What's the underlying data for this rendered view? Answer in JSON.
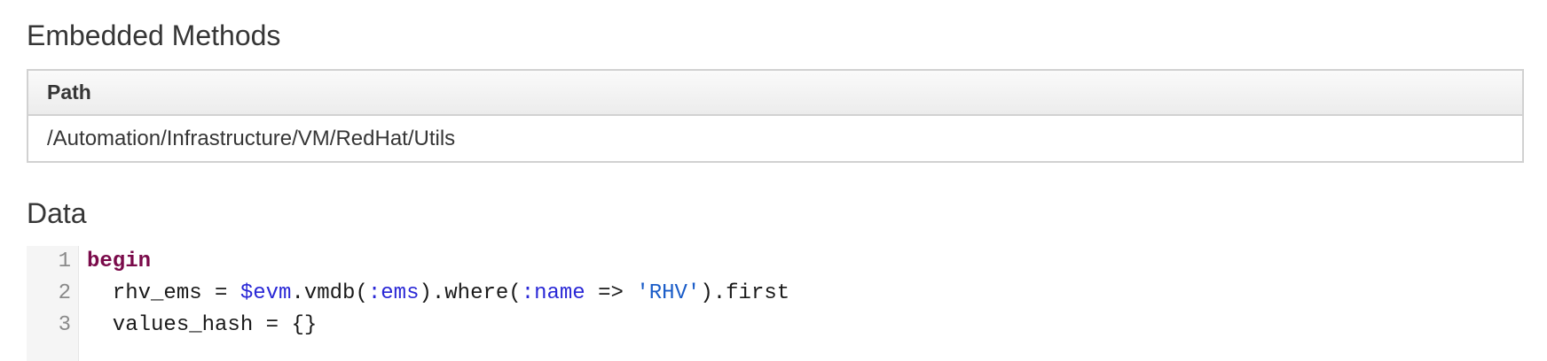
{
  "embedded_methods": {
    "heading": "Embedded Methods",
    "table": {
      "columns": [
        "Path"
      ],
      "rows": [
        [
          "/Automation/Infrastructure/VM/RedHat/Utils"
        ]
      ]
    }
  },
  "data_section": {
    "heading": "Data",
    "code_lines": [
      {
        "number": "1",
        "tokens": [
          {
            "text": "begin",
            "kind": "keyword"
          }
        ]
      },
      {
        "number": "2",
        "tokens": [
          {
            "text": "  rhv_ems = ",
            "kind": "plain"
          },
          {
            "text": "$evm",
            "kind": "global-variable"
          },
          {
            "text": ".vmdb(",
            "kind": "plain"
          },
          {
            "text": ":ems",
            "kind": "symbol"
          },
          {
            "text": ").where(",
            "kind": "plain"
          },
          {
            "text": ":name",
            "kind": "symbol"
          },
          {
            "text": " => ",
            "kind": "plain"
          },
          {
            "text": "'RHV'",
            "kind": "string"
          },
          {
            "text": ").first",
            "kind": "plain"
          }
        ]
      },
      {
        "number": "3",
        "tokens": [
          {
            "text": "  values_hash = {}",
            "kind": "plain"
          }
        ]
      }
    ]
  },
  "colors": {
    "keyword": "#7a0a4a",
    "global_variable": "#2a28d6",
    "symbol": "#2a28d6",
    "string": "#1a5cc8",
    "line_number": "#8a8a8a",
    "table_border": "#d1d1d1"
  }
}
